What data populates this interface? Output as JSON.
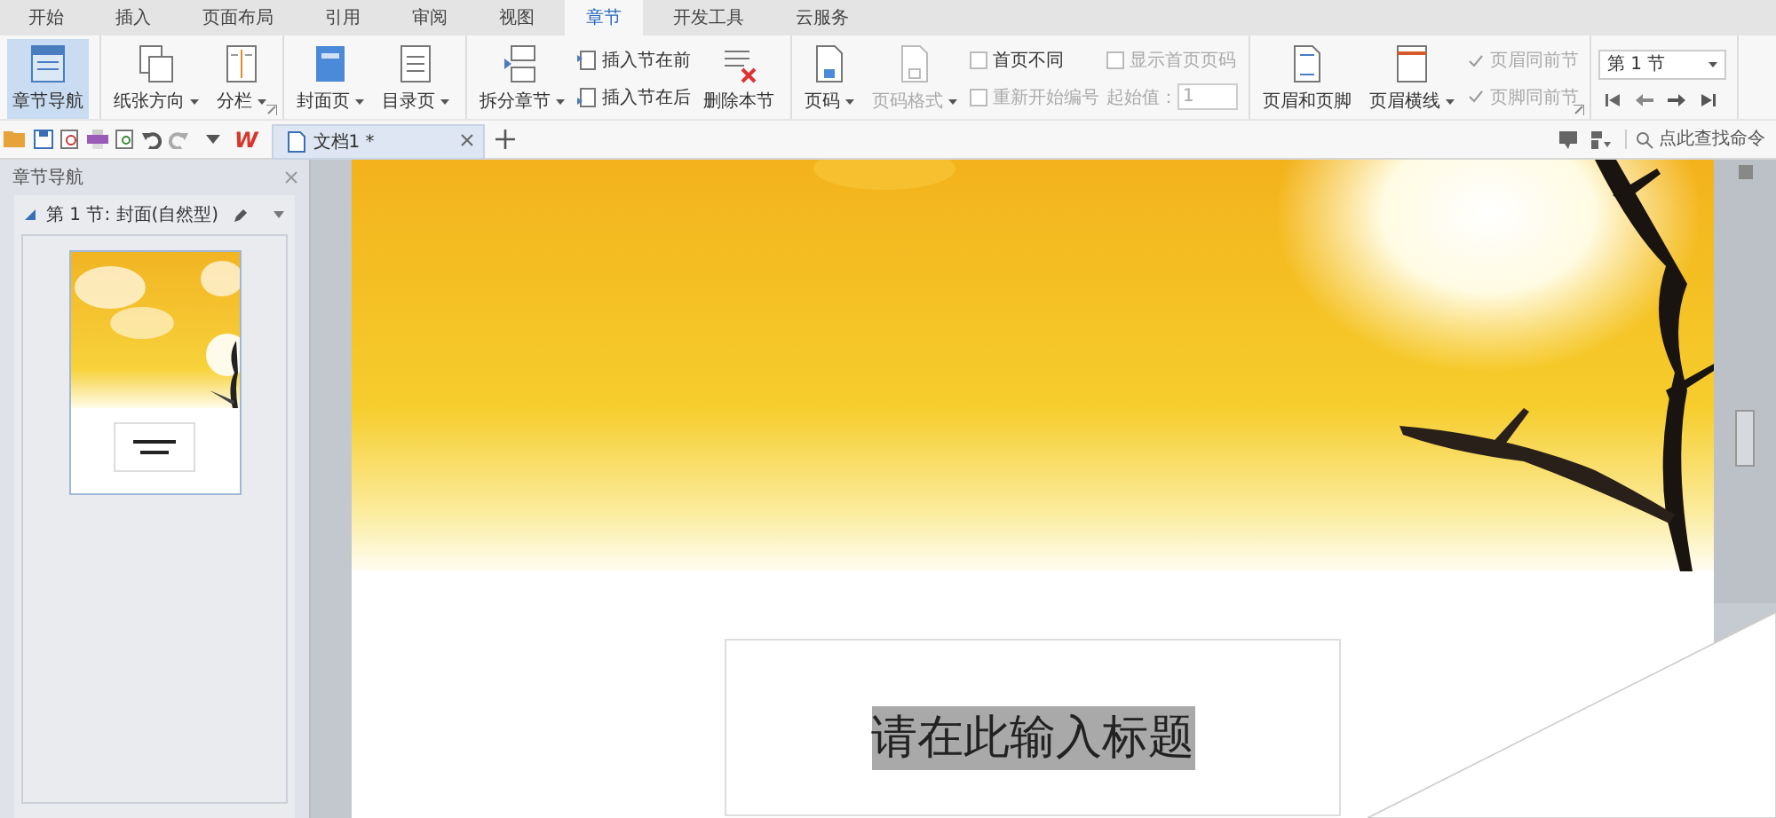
{
  "menu_tabs": [
    {
      "label": "开始",
      "selected": false
    },
    {
      "label": "插入",
      "selected": false
    },
    {
      "label": "页面布局",
      "selected": false
    },
    {
      "label": "引用",
      "selected": false
    },
    {
      "label": "审阅",
      "selected": false
    },
    {
      "label": "视图",
      "selected": false
    },
    {
      "label": "章节",
      "selected": true
    },
    {
      "label": "开发工具",
      "selected": false
    },
    {
      "label": "云服务",
      "selected": false
    }
  ],
  "ribbon": [
    {
      "launcher": false,
      "items": [
        {
          "kind": "large",
          "label": "章节导航",
          "dropdown": false,
          "selected": true,
          "disabled": false
        }
      ]
    },
    {
      "launcher": true,
      "items": [
        {
          "kind": "large",
          "label": "纸张方向",
          "dropdown": true,
          "selected": false,
          "disabled": false
        },
        {
          "kind": "large",
          "label": "分栏",
          "dropdown": true,
          "selected": false,
          "disabled": false
        }
      ]
    },
    {
      "launcher": false,
      "items": [
        {
          "kind": "large",
          "label": "封面页",
          "dropdown": true,
          "selected": false,
          "disabled": false
        },
        {
          "kind": "large",
          "label": "目录页",
          "dropdown": true,
          "selected": false,
          "disabled": false
        }
      ]
    },
    {
      "launcher": false,
      "items": [
        {
          "kind": "large",
          "label": "拆分章节",
          "dropdown": true,
          "selected": false,
          "disabled": false
        },
        {
          "kind": "stack",
          "rows": [
            {
              "label": "插入节在前"
            },
            {
              "label": "插入节在后"
            }
          ]
        },
        {
          "kind": "large",
          "label": "删除本节",
          "dropdown": false,
          "selected": false,
          "disabled": false
        }
      ]
    },
    {
      "launcher": false,
      "items": [
        {
          "kind": "large",
          "label": "页码",
          "dropdown": true,
          "selected": false,
          "disabled": false
        },
        {
          "kind": "large",
          "label": "页码格式",
          "dropdown": true,
          "selected": false,
          "disabled": true
        },
        {
          "kind": "checks",
          "rows": [
            {
              "kind": "check",
              "label": "首页不同",
              "checked": false,
              "disabled": false
            },
            {
              "kind": "check",
              "label": "重新开始编号",
              "checked": false,
              "disabled": true
            }
          ]
        },
        {
          "kind": "checks",
          "rows": [
            {
              "kind": "check",
              "label": "显示首页页码",
              "checked": false,
              "disabled": true
            },
            {
              "kind": "spin",
              "label": "起始值：",
              "value": "1",
              "disabled": true
            }
          ]
        }
      ]
    },
    {
      "launcher": true,
      "items": [
        {
          "kind": "large",
          "label": "页眉和页脚",
          "dropdown": false,
          "selected": false,
          "disabled": false
        },
        {
          "kind": "large",
          "label": "页眉横线",
          "dropdown": true,
          "selected": false,
          "disabled": false
        },
        {
          "kind": "checks",
          "rows": [
            {
              "kind": "check",
              "label": "页眉同前节",
              "checked": true,
              "disabled": true
            },
            {
              "kind": "check",
              "label": "页脚同前节",
              "checked": true,
              "disabled": true
            }
          ]
        }
      ]
    },
    {
      "launcher": false,
      "items": [
        {
          "kind": "section_nav",
          "value": "第 1 节"
        }
      ]
    }
  ],
  "quick_bar": {
    "logo": "W",
    "doc_tabs": [
      {
        "label": "文档1 *",
        "selected": true
      }
    ],
    "search": {
      "placeholder": "点此查找命令"
    }
  },
  "sidebar": {
    "title": "章节导航",
    "sections": [
      {
        "label": "第 1 节: 封面(自然型)",
        "expanded": true
      }
    ]
  },
  "document": {
    "title_placeholder": "请在此输入标题",
    "title_selected": true
  }
}
